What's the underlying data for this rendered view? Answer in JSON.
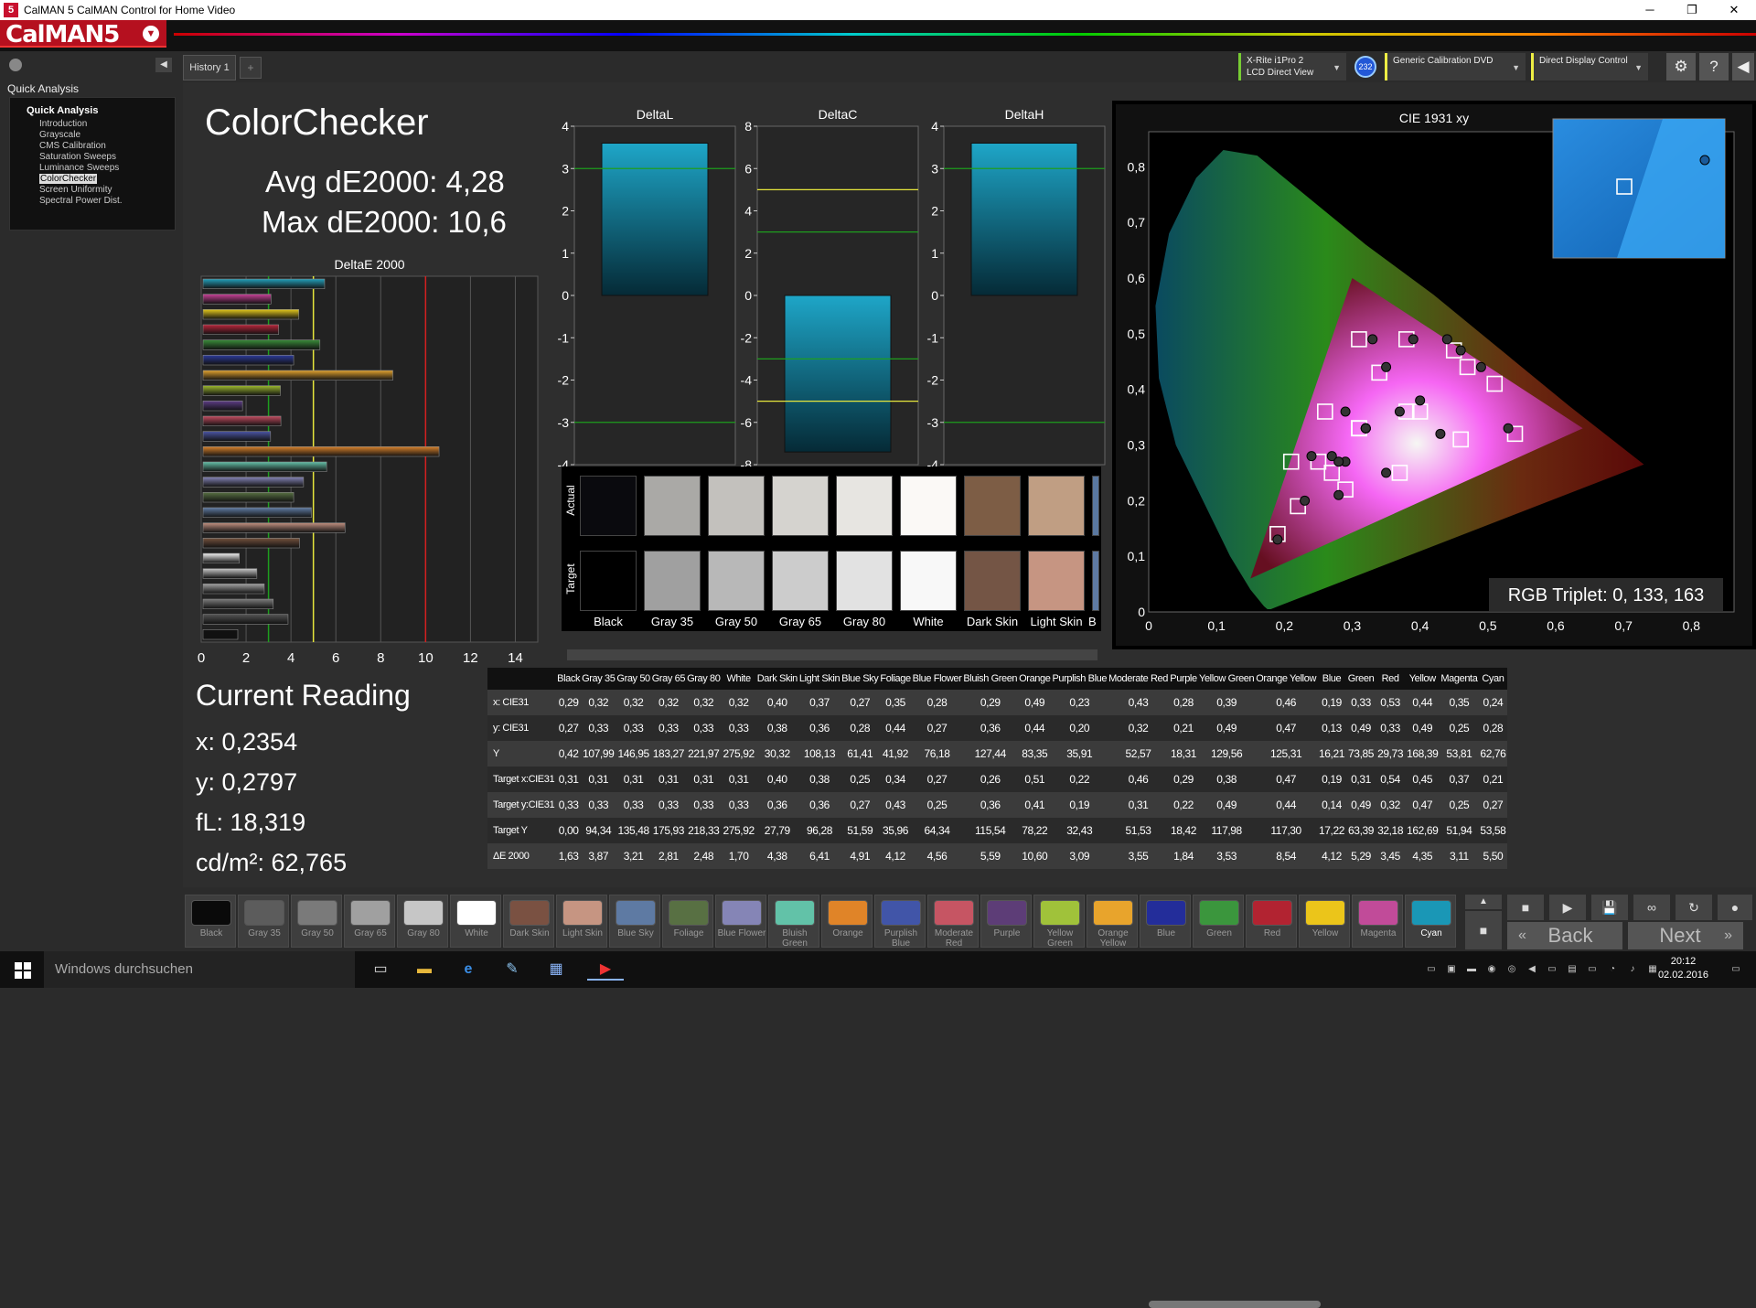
{
  "window": {
    "title": "CalMAN 5 CalMAN Control for Home Video",
    "logo": "CalMAN5",
    "app_icon": "5"
  },
  "winctl": {
    "minimize": "─",
    "maximize": "❐",
    "close": "✕"
  },
  "left": {
    "section_title": "Quick Analysis",
    "collapse": "◀",
    "root": "Quick Analysis",
    "items": [
      {
        "label": "Introduction"
      },
      {
        "label": "Grayscale"
      },
      {
        "label": "CMS Calibration"
      },
      {
        "label": "Saturation Sweeps"
      },
      {
        "label": "Luminance Sweeps"
      },
      {
        "label": "ColorChecker",
        "selected": true
      },
      {
        "label": "Screen Uniformity"
      },
      {
        "label": "Spectral Power Dist."
      }
    ]
  },
  "tabs": {
    "history": "History 1",
    "add": "+"
  },
  "devices": {
    "meter_line1": "X-Rite i1Pro 2",
    "meter_line2": "LCD Direct View",
    "badge": "232",
    "source": "Generic Calibration DVD",
    "display": "Direct Display Control",
    "dd": "▼"
  },
  "top_icons": {
    "settings": "⚙",
    "help": "?",
    "collapse": "◀"
  },
  "summary": {
    "title": "ColorChecker",
    "avg": "Avg dE2000: 4,28",
    "max": "Max dE2000: 10,6"
  },
  "delta_e_chart": {
    "title": "DeltaE 2000",
    "ticks": [
      "0",
      "2",
      "4",
      "6",
      "8",
      "10",
      "12",
      "14"
    ],
    "xlim": [
      0,
      15
    ],
    "thresholds": [
      {
        "value": 3,
        "color": "#1e9e1e"
      },
      {
        "value": 5,
        "color": "#e6e63c"
      },
      {
        "value": 10,
        "color": "#d42020"
      }
    ]
  },
  "chart_data": [
    {
      "type": "bar",
      "title": "DeltaE 2000",
      "categories": [
        "Cyan",
        "Magenta",
        "Yellow",
        "Red",
        "Green",
        "Blue",
        "Orange Yellow",
        "Yellow Green",
        "Purple",
        "Moderate Red",
        "Purplish Blue",
        "Orange",
        "Bluish Green",
        "Blue Flower",
        "Foliage",
        "Blue Sky",
        "Light Skin",
        "Dark Skin",
        "White",
        "Gray 80",
        "Gray 65",
        "Gray 50",
        "Gray 35",
        "Black"
      ],
      "values": [
        5.5,
        3.11,
        4.35,
        3.45,
        5.29,
        4.12,
        8.54,
        3.53,
        1.84,
        3.55,
        3.09,
        10.6,
        5.59,
        4.56,
        4.12,
        4.91,
        6.41,
        4.38,
        1.7,
        2.48,
        2.81,
        3.21,
        3.87,
        1.63
      ],
      "colors": [
        "#23a0bb",
        "#c64196",
        "#e3c81c",
        "#b8263b",
        "#3a8c3a",
        "#2c3a99",
        "#e0a12d",
        "#9cb82f",
        "#5d3d86",
        "#c24b5f",
        "#4b55a3",
        "#d7802a",
        "#64c0a8",
        "#8383b4",
        "#587043",
        "#607ca4",
        "#c09080",
        "#74513d",
        "#f2f2f2",
        "#c8c8c8",
        "#a0a0a0",
        "#7b7b7b",
        "#545454",
        "#111111"
      ],
      "xlim": [
        0,
        15
      ]
    },
    {
      "type": "bar",
      "title": "DeltaL",
      "ylim": [
        -4,
        4
      ],
      "ticks": [
        "4",
        "3",
        "2",
        "1",
        "0",
        "-1",
        "-2",
        "-3",
        "-4"
      ],
      "bar": [
        0,
        3.6
      ],
      "lines": [
        {
          "value": 3,
          "color": "#1e9e1e"
        },
        {
          "value": -3,
          "color": "#1e9e1e"
        }
      ]
    },
    {
      "type": "bar",
      "title": "DeltaC",
      "ylim": [
        -8,
        8
      ],
      "ticks": [
        "8",
        "6",
        "4",
        "2",
        "0",
        "-2",
        "-4",
        "-6",
        "-8"
      ],
      "bar": [
        -7.4,
        0
      ],
      "lines": [
        {
          "value": 5,
          "color": "#e6e63c"
        },
        {
          "value": 3,
          "color": "#1e9e1e"
        },
        {
          "value": -3,
          "color": "#1e9e1e"
        },
        {
          "value": -5,
          "color": "#e6e63c"
        }
      ]
    },
    {
      "type": "bar",
      "title": "DeltaH",
      "ylim": [
        -4,
        4
      ],
      "ticks": [
        "4",
        "3",
        "2",
        "1",
        "0",
        "-1",
        "-2",
        "-3",
        "-4"
      ],
      "bar": [
        0,
        3.6
      ],
      "lines": [
        {
          "value": 3,
          "color": "#1e9e1e"
        },
        {
          "value": -3,
          "color": "#1e9e1e"
        }
      ]
    },
    {
      "type": "scatter",
      "title": "CIE 1931 xy",
      "xlim": [
        0,
        0.85
      ],
      "ylim": [
        0,
        0.85
      ],
      "xticks": [
        "0",
        "0,1",
        "0,2",
        "0,3",
        "0,4",
        "0,5",
        "0,6",
        "0,7",
        "0,8"
      ],
      "yticks": [
        "0",
        "0,1",
        "0,2",
        "0,3",
        "0,4",
        "0,5",
        "0,6",
        "0,7",
        "0,8"
      ],
      "series": [
        {
          "values": [
            [
              0.29,
              0.27
            ],
            [
              0.32,
              0.33
            ],
            [
              0.32,
              0.33
            ],
            [
              0.32,
              0.33
            ],
            [
              0.32,
              0.33
            ],
            [
              0.32,
              0.33
            ],
            [
              0.4,
              0.38
            ],
            [
              0.37,
              0.36
            ],
            [
              0.27,
              0.28
            ],
            [
              0.35,
              0.44
            ],
            [
              0.28,
              0.27
            ],
            [
              0.29,
              0.36
            ],
            [
              0.49,
              0.44
            ],
            [
              0.23,
              0.2
            ],
            [
              0.43,
              0.32
            ],
            [
              0.28,
              0.21
            ],
            [
              0.39,
              0.49
            ],
            [
              0.46,
              0.47
            ],
            [
              0.19,
              0.13
            ],
            [
              0.33,
              0.49
            ],
            [
              0.53,
              0.33
            ],
            [
              0.44,
              0.49
            ],
            [
              0.35,
              0.25
            ],
            [
              0.24,
              0.28
            ]
          ]
        },
        {
          "values": [
            [
              0.31,
              0.33
            ],
            [
              0.31,
              0.33
            ],
            [
              0.31,
              0.33
            ],
            [
              0.31,
              0.33
            ],
            [
              0.31,
              0.33
            ],
            [
              0.31,
              0.33
            ],
            [
              0.4,
              0.36
            ],
            [
              0.38,
              0.36
            ],
            [
              0.25,
              0.27
            ],
            [
              0.34,
              0.43
            ],
            [
              0.27,
              0.25
            ],
            [
              0.26,
              0.36
            ],
            [
              0.51,
              0.41
            ],
            [
              0.22,
              0.19
            ],
            [
              0.46,
              0.31
            ],
            [
              0.29,
              0.22
            ],
            [
              0.38,
              0.49
            ],
            [
              0.47,
              0.44
            ],
            [
              0.19,
              0.14
            ],
            [
              0.31,
              0.49
            ],
            [
              0.54,
              0.32
            ],
            [
              0.45,
              0.47
            ],
            [
              0.37,
              0.25
            ],
            [
              0.21,
              0.27
            ]
          ]
        }
      ]
    }
  ],
  "cie": {
    "rgb_triplet": "RGB Triplet: 0, 133, 163"
  },
  "swatch_panel": {
    "row_actual": "Actual",
    "row_target": "Target",
    "items": [
      {
        "label": "Black",
        "actual": "#0a0a0e",
        "target": "#000000"
      },
      {
        "label": "Gray 35",
        "actual": "#aaa9a6",
        "target": "#a0a0a0"
      },
      {
        "label": "Gray 50",
        "actual": "#c3c1bd",
        "target": "#b8b8b8"
      },
      {
        "label": "Gray 65",
        "actual": "#d5d3cf",
        "target": "#cccccc"
      },
      {
        "label": "Gray 80",
        "actual": "#e7e5e1",
        "target": "#e2e2e2"
      },
      {
        "label": "White",
        "actual": "#fbf9f6",
        "target": "#f8f8f8"
      },
      {
        "label": "Dark Skin",
        "actual": "#7d5d45",
        "target": "#745545"
      },
      {
        "label": "Light Skin",
        "actual": "#c09e83",
        "target": "#c69582"
      },
      {
        "label": "B",
        "actual": "#5a78a0",
        "target": "#5e7aa3"
      }
    ]
  },
  "table": {
    "headers": [
      "Black",
      "Gray 35",
      "Gray 50",
      "Gray 65",
      "Gray 80",
      "White",
      "Dark Skin",
      "Light Skin",
      "Blue Sky",
      "Foliage",
      "Blue Flower",
      "Bluish Green",
      "Orange",
      "Purplish Blue",
      "Moderate Red",
      "Purple",
      "Yellow Green",
      "Orange Yellow",
      "Blue",
      "Green",
      "Red",
      "Yellow",
      "Magenta",
      "Cyan"
    ],
    "rows": [
      {
        "label": "x: CIE31",
        "values": [
          "0,29",
          "0,32",
          "0,32",
          "0,32",
          "0,32",
          "0,32",
          "0,40",
          "0,37",
          "0,27",
          "0,35",
          "0,28",
          "0,29",
          "0,49",
          "0,23",
          "0,43",
          "0,28",
          "0,39",
          "0,46",
          "0,19",
          "0,33",
          "0,53",
          "0,44",
          "0,35",
          "0,24"
        ]
      },
      {
        "label": "y: CIE31",
        "values": [
          "0,27",
          "0,33",
          "0,33",
          "0,33",
          "0,33",
          "0,33",
          "0,38",
          "0,36",
          "0,28",
          "0,44",
          "0,27",
          "0,36",
          "0,44",
          "0,20",
          "0,32",
          "0,21",
          "0,49",
          "0,47",
          "0,13",
          "0,49",
          "0,33",
          "0,49",
          "0,25",
          "0,28"
        ]
      },
      {
        "label": "Y",
        "values": [
          "0,42",
          "107,99",
          "146,95",
          "183,27",
          "221,97",
          "275,92",
          "30,32",
          "108,13",
          "61,41",
          "41,92",
          "76,18",
          "127,44",
          "83,35",
          "35,91",
          "52,57",
          "18,31",
          "129,56",
          "125,31",
          "16,21",
          "73,85",
          "29,73",
          "168,39",
          "53,81",
          "62,76"
        ]
      },
      {
        "label": "Target x:CIE31",
        "values": [
          "0,31",
          "0,31",
          "0,31",
          "0,31",
          "0,31",
          "0,31",
          "0,40",
          "0,38",
          "0,25",
          "0,34",
          "0,27",
          "0,26",
          "0,51",
          "0,22",
          "0,46",
          "0,29",
          "0,38",
          "0,47",
          "0,19",
          "0,31",
          "0,54",
          "0,45",
          "0,37",
          "0,21"
        ]
      },
      {
        "label": "Target y:CIE31",
        "values": [
          "0,33",
          "0,33",
          "0,33",
          "0,33",
          "0,33",
          "0,33",
          "0,36",
          "0,36",
          "0,27",
          "0,43",
          "0,25",
          "0,36",
          "0,41",
          "0,19",
          "0,31",
          "0,22",
          "0,49",
          "0,44",
          "0,14",
          "0,49",
          "0,32",
          "0,47",
          "0,25",
          "0,27"
        ]
      },
      {
        "label": "Target Y",
        "values": [
          "0,00",
          "94,34",
          "135,48",
          "175,93",
          "218,33",
          "275,92",
          "27,79",
          "96,28",
          "51,59",
          "35,96",
          "64,34",
          "115,54",
          "78,22",
          "32,43",
          "51,53",
          "18,42",
          "117,98",
          "117,30",
          "17,22",
          "63,39",
          "32,18",
          "162,69",
          "51,94",
          "53,58"
        ]
      },
      {
        "label": "ΔE 2000",
        "values": [
          "1,63",
          "3,87",
          "3,21",
          "2,81",
          "2,48",
          "1,70",
          "4,38",
          "6,41",
          "4,91",
          "4,12",
          "4,56",
          "5,59",
          "10,60",
          "3,09",
          "3,55",
          "1,84",
          "3,53",
          "8,54",
          "4,12",
          "5,29",
          "3,45",
          "4,35",
          "3,11",
          "5,50"
        ]
      }
    ]
  },
  "reading": {
    "title": "Current Reading",
    "x": "x: 0,2354",
    "y": "y: 0,2797",
    "fl": "fL: 18,319",
    "cd": "cd/m²: 62,765"
  },
  "bottom_swatches": [
    {
      "label": "Black",
      "color": "#0a0a0a"
    },
    {
      "label": "Gray 35",
      "color": "#5c5c5c"
    },
    {
      "label": "Gray 50",
      "color": "#7a7a7a"
    },
    {
      "label": "Gray 65",
      "color": "#a0a0a0"
    },
    {
      "label": "Gray 80",
      "color": "#c6c6c6"
    },
    {
      "label": "White",
      "color": "#ffffff"
    },
    {
      "label": "Dark Skin",
      "color": "#7a5142"
    },
    {
      "label": "Light Skin",
      "color": "#c69582"
    },
    {
      "label": "Blue Sky",
      "color": "#5e7aa3"
    },
    {
      "label": "Foliage",
      "color": "#587043"
    },
    {
      "label": "Blue Flower",
      "color": "#8585b6"
    },
    {
      "label": "Bluish Green",
      "color": "#62c2a8"
    },
    {
      "label": "Orange",
      "color": "#e08428"
    },
    {
      "label": "Purplish Blue",
      "color": "#4155a8"
    },
    {
      "label": "Moderate Red",
      "color": "#c65563"
    },
    {
      "label": "Purple",
      "color": "#5d3d77"
    },
    {
      "label": "Yellow Green",
      "color": "#a0c23a"
    },
    {
      "label": "Orange Yellow",
      "color": "#e8a42c"
    },
    {
      "label": "Blue",
      "color": "#232d9a"
    },
    {
      "label": "Green",
      "color": "#3b963d"
    },
    {
      "label": "Red",
      "color": "#b22331"
    },
    {
      "label": "Yellow",
      "color": "#ebc51a"
    },
    {
      "label": "Magenta",
      "color": "#c14b99"
    },
    {
      "label": "Cyan",
      "color": "#1a97b6",
      "active": true
    }
  ],
  "controls": {
    "up": "▲",
    "stop": "■",
    "play": "▶",
    "save": "💾",
    "loop": "∞",
    "refresh": "↻",
    "circle": "●",
    "back": "Back",
    "next": "Next",
    "back_arrow": "«",
    "next_arrow": "»"
  },
  "taskbar": {
    "search": "Windows durchsuchen",
    "time": "20:12",
    "date": "02.02.2016"
  }
}
